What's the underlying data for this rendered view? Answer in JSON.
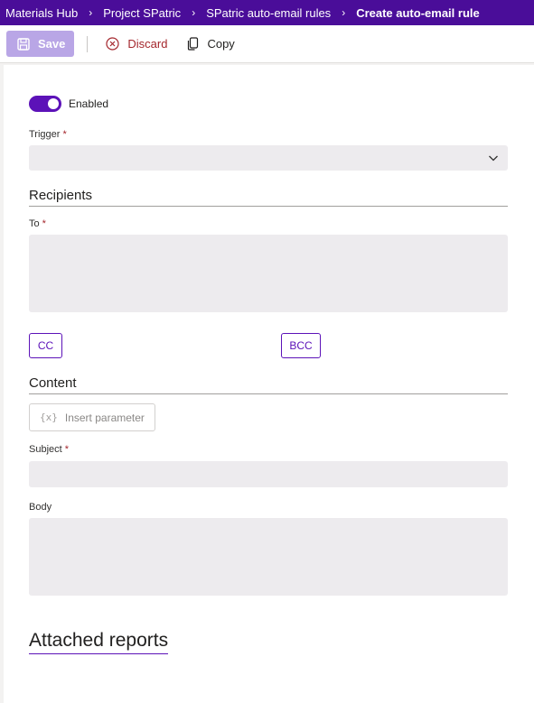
{
  "breadcrumb": {
    "items": [
      "Materials Hub",
      "Project SPatric",
      "SPatric auto-email rules"
    ],
    "current": "Create auto-email rule",
    "separator": "›"
  },
  "toolbar": {
    "save_label": "Save",
    "discard_label": "Discard",
    "copy_label": "Copy"
  },
  "form": {
    "enabled_label": "Enabled",
    "enabled": true,
    "trigger_label": "Trigger",
    "trigger_value": "",
    "required_mark": "*",
    "recipients_title": "Recipients",
    "to_label": "To",
    "cc_label": "CC",
    "bcc_label": "BCC",
    "content_title": "Content",
    "insert_param_icon": "{x}",
    "insert_param_label": "Insert parameter",
    "subject_label": "Subject",
    "body_label": "Body",
    "attached_title": "Attached reports"
  },
  "colors": {
    "brand": "#4a0d99",
    "accent": "#5c12b8",
    "danger": "#a4262c",
    "input_bg": "#edebee"
  },
  "icons": {
    "save": "save-icon",
    "discard": "discard-icon",
    "copy": "copy-icon",
    "dropdown": "chevron-down-icon"
  }
}
